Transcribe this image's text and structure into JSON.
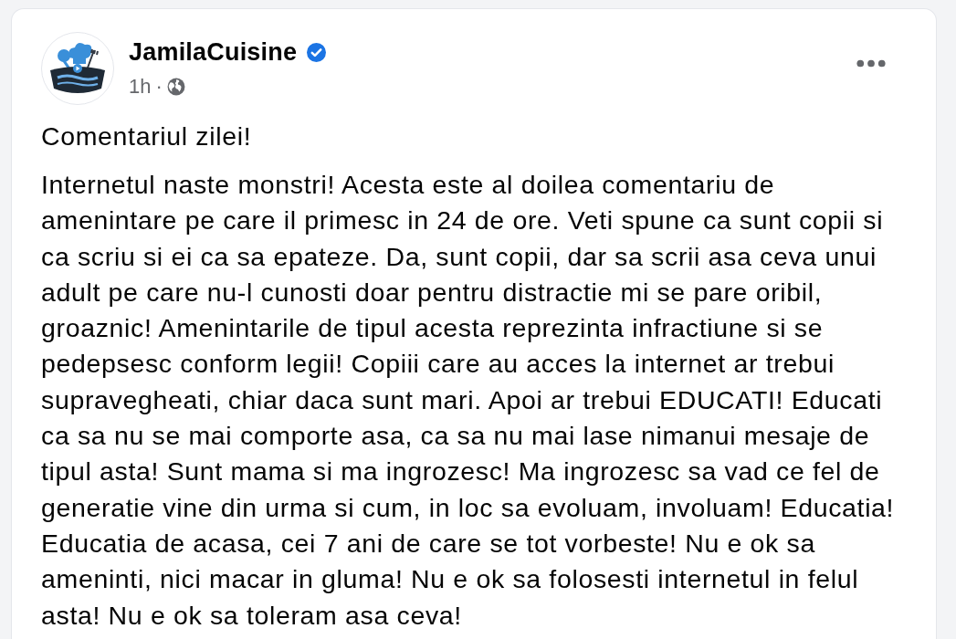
{
  "post": {
    "author": {
      "name": "JamilaCuisine",
      "verified": true
    },
    "time": "1h",
    "separator": "·",
    "title": "Comentariul zilei!",
    "body_lines": [
      "Internetul naste monstri! Acesta este al doilea comentariu de",
      "amenintare pe care il primesc in 24 de ore. Veti spune ca sunt copii si",
      "ca scriu si ei ca sa epateze. Da, sunt copii, dar sa scrii asa ceva unui",
      "adult pe care nu-l cunosti doar pentru distractie mi se pare oribil,",
      "groaznic! Amenintarile de tipul acesta reprezinta infractiune si se",
      "pedepsesc conform legii! Copiii care au acces la internet ar trebui",
      "supravegheati, chiar daca sunt mari. Apoi ar trebui EDUCATI! Educati",
      "ca sa nu se mai comporte asa, ca sa nu mai lase nimanui mesaje de",
      "tipul asta! Sunt mama si ma ingrozesc! Ma ingrozesc sa vad ce fel de",
      "generatie vine din urma si cum, in loc sa evoluam, involuam! Educatia!",
      "Educatia de acasa, cei 7 ani de care se tot vorbeste! Nu e ok sa",
      "ameninti, nici macar in gluma! Nu e ok sa folosesti internetul in felul",
      "asta! Nu e ok sa toleram asa ceva!"
    ]
  }
}
